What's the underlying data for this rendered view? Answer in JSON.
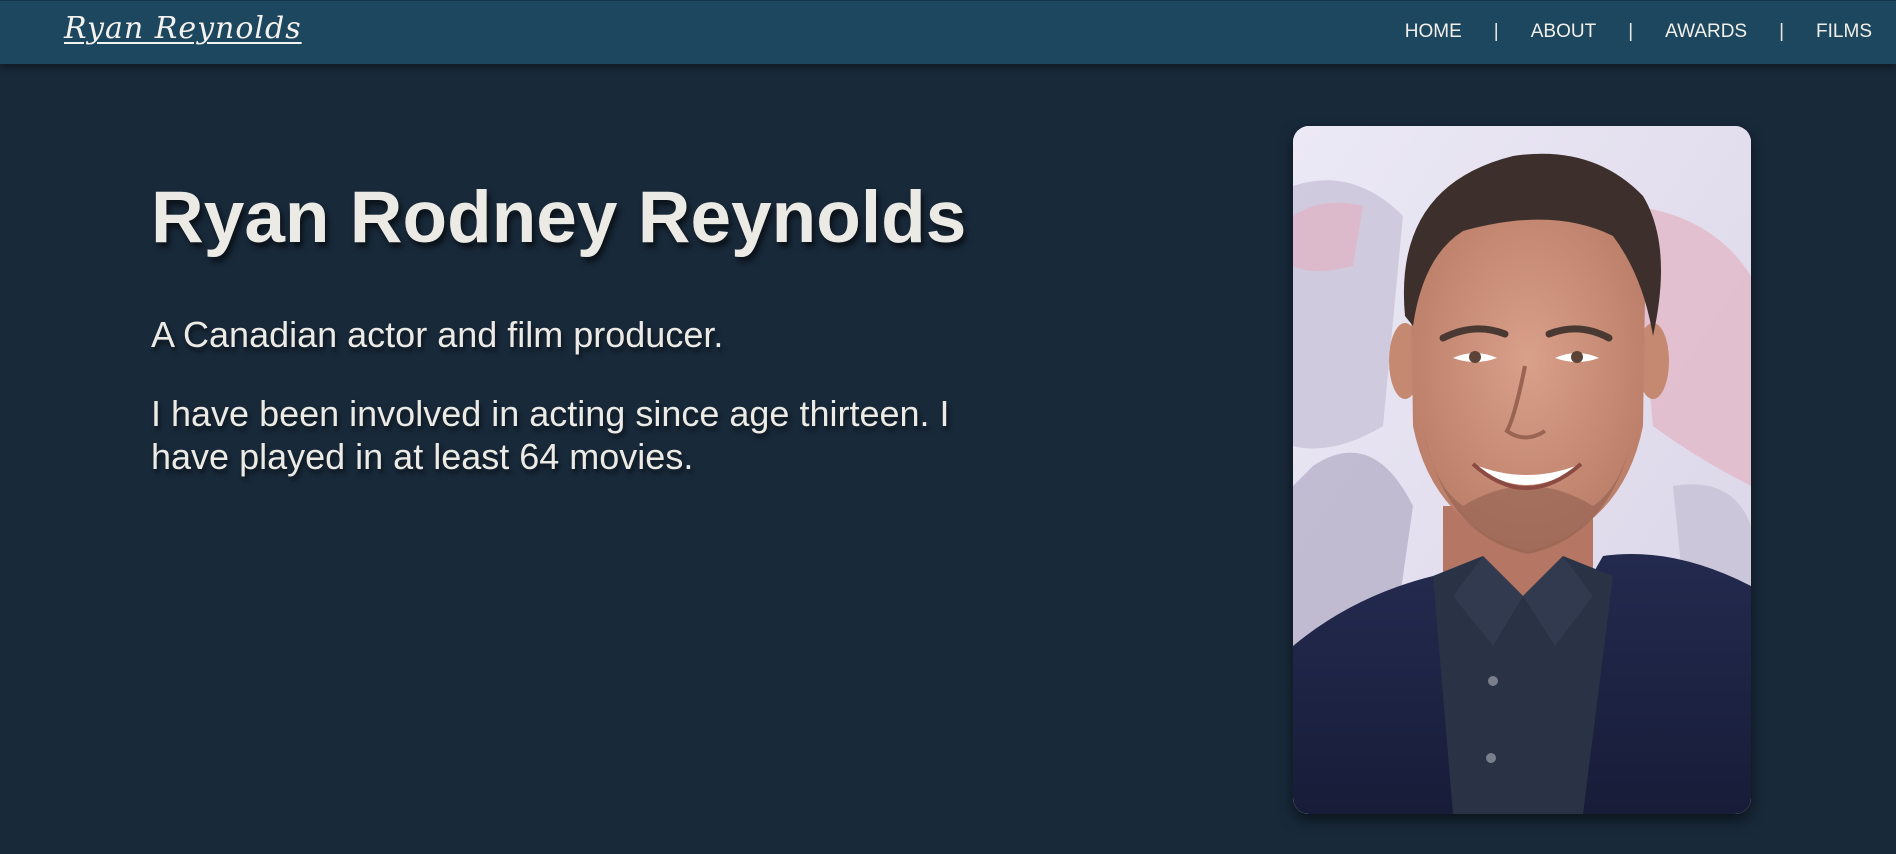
{
  "header": {
    "logo_text": "Ryan Reynolds",
    "nav": [
      {
        "label": "HOME"
      },
      {
        "label": "ABOUT"
      },
      {
        "label": "AWARDS"
      },
      {
        "label": "FILMS"
      }
    ],
    "separator": "|"
  },
  "hero": {
    "title": "Ryan Rodney Reynolds",
    "subtitle": "A Canadian actor and film producer.",
    "body": "I have been involved in acting since age thirteen. I have played in at least 64 movies."
  },
  "photo": {
    "subject": "portrait of Ryan Reynolds"
  },
  "colors": {
    "background": "#18293a",
    "navbar": "#1d475f",
    "text": "#eceae5"
  }
}
